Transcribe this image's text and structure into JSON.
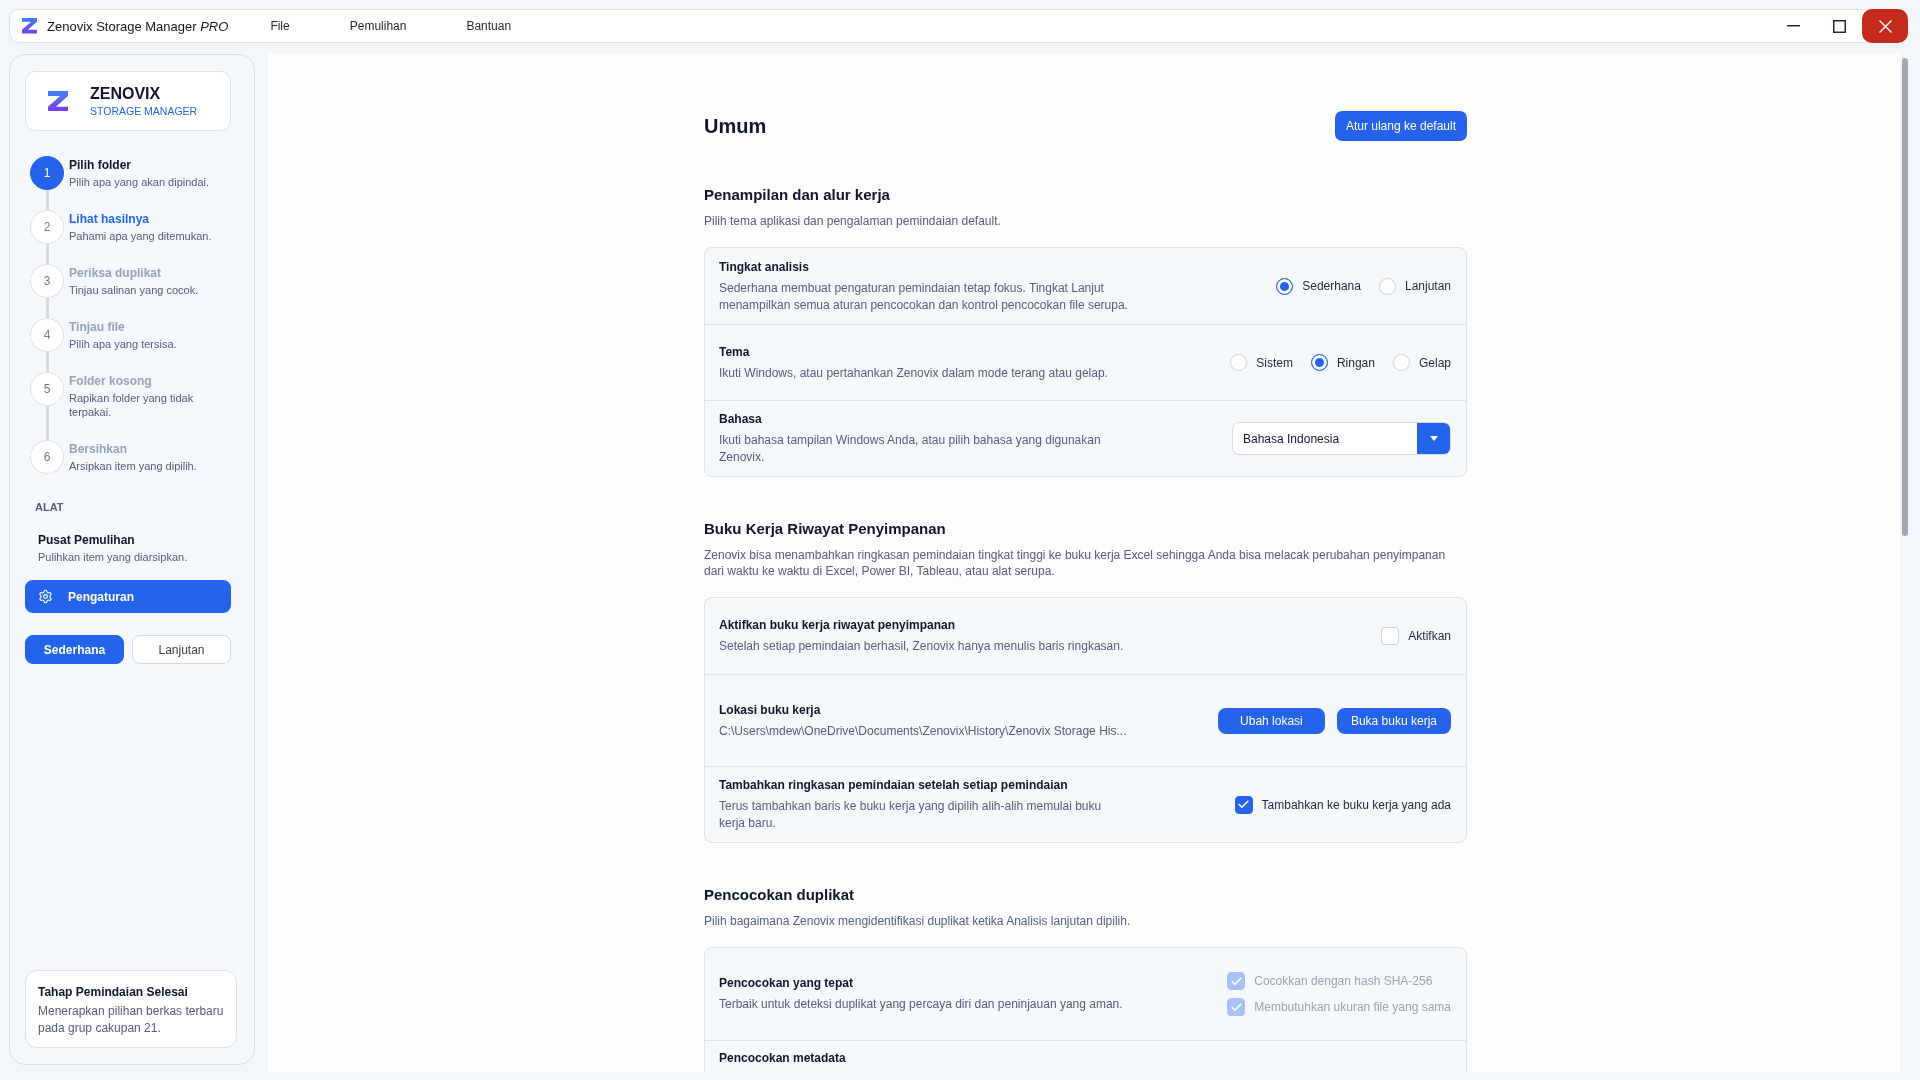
{
  "window": {
    "title": "Zenovix Storage Manager *PRO*",
    "menu": [
      {
        "label": "File"
      },
      {
        "label": "Pemulihan"
      },
      {
        "label": "Bantuan"
      }
    ]
  },
  "sidebar": {
    "brand": {
      "name": "ZENOVIX",
      "tagline": "STORAGE MANAGER"
    },
    "steps": [
      {
        "number": "1",
        "title": "Pilih folder",
        "description": "Pilih apa yang akan dipindai.",
        "completed": true,
        "selected": false
      },
      {
        "number": "2",
        "title": "Lihat hasilnya",
        "description": "Pahami apa yang ditemukan.",
        "completed": false,
        "selected": true
      },
      {
        "number": "3",
        "title": "Periksa duplikat",
        "description": "Tinjau salinan yang cocok.",
        "completed": false,
        "selected": false
      },
      {
        "number": "4",
        "title": "Tinjau file",
        "description": "Pilih apa yang tersisa.",
        "completed": false,
        "selected": false
      },
      {
        "number": "5",
        "title": "Folder kosong",
        "description": "Rapikan folder yang tidak terpakai.",
        "completed": false,
        "selected": false
      },
      {
        "number": "6",
        "title": "Bersihkan",
        "description": "Arsipkan item yang dipilih.",
        "completed": false,
        "selected": false
      }
    ],
    "tools_heading": "ALAT",
    "tools": [
      {
        "kind": "page",
        "title": "Pusat Pemulihan",
        "description": "Pulihkan item yang diarsipkan.",
        "selected": false
      },
      {
        "kind": "settings",
        "title": "Pengaturan",
        "selected": true
      }
    ],
    "modes": [
      {
        "label": "Sederhana",
        "selected": true
      },
      {
        "label": "Lanjutan",
        "selected": false
      }
    ],
    "status_card": {
      "title": "Tahap Pemindaian Selesai",
      "text": "Menerapkan pilihan berkas terbaru pada grup cakupan 21."
    }
  },
  "settings": {
    "title": "Umum",
    "reset_button": "Atur ulang ke default",
    "sections": [
      {
        "heading": "Penampilan dan alur kerja",
        "description": "Pilih tema aplikasi dan pengalaman pemindaian default.",
        "rows": [
          {
            "kind": "radio",
            "title": "Tingkat analisis",
            "description": "Sederhana membuat pengaturan pemindaian tetap fokus. Tingkat Lanjut menampilkan semua aturan pencocokan dan kontrol pencocokan file serupa.",
            "options": [
              {
                "label": "Sederhana",
                "selected": true
              },
              {
                "label": "Lanjutan",
                "selected": false
              }
            ]
          },
          {
            "kind": "radio",
            "title": "Tema",
            "description": "Ikuti Windows, atau pertahankan Zenovix dalam mode terang atau gelap.",
            "options": [
              {
                "label": "Sistem",
                "selected": false
              },
              {
                "label": "Ringan",
                "selected": true
              },
              {
                "label": "Gelap",
                "selected": false
              }
            ]
          },
          {
            "kind": "select",
            "title": "Bahasa",
            "description": "Ikuti bahasa tampilan Windows Anda, atau pilih bahasa yang digunakan Zenovix.",
            "value": "Bahasa Indonesia"
          }
        ]
      },
      {
        "heading": "Buku Kerja Riwayat Penyimpanan",
        "description": "Zenovix bisa menambahkan ringkasan pemindaian tingkat tinggi ke buku kerja Excel sehingga Anda bisa melacak perubahan penyimpanan dari waktu ke waktu di Excel, Power BI, Tableau, atau alat serupa.",
        "rows": [
          {
            "kind": "checkbox",
            "title": "Aktifkan buku kerja riwayat penyimpanan",
            "description": "Setelah setiap pemindaian berhasil, Zenovix hanya menulis baris ringkasan.",
            "options": [
              {
                "label": "Aktifkan",
                "checked": false,
                "disabled": false
              }
            ]
          },
          {
            "kind": "buttons",
            "title": "Lokasi buku kerja",
            "path": "C:\\Users\\mdew\\OneDrive\\Documents\\Zenovix\\History\\Zenovix Storage His...",
            "buttons": [
              {
                "label": "Ubah lokasi"
              },
              {
                "label": "Buka buku kerja"
              }
            ]
          },
          {
            "kind": "checkbox",
            "title": "Tambahkan ringkasan pemindaian setelah setiap pemindaian",
            "description": "Terus tambahkan baris ke buku kerja yang dipilih alih-alih memulai buku kerja baru.",
            "options": [
              {
                "label": "Tambahkan ke buku kerja yang ada",
                "checked": true,
                "disabled": false
              }
            ]
          }
        ]
      },
      {
        "heading": "Pencocokan duplikat",
        "description": "Pilih bagaimana Zenovix mengidentifikasi duplikat ketika Analisis lanjutan dipilih.",
        "rows": [
          {
            "kind": "checkbox",
            "title": "Pencocokan yang tepat",
            "description": "Terbaik untuk deteksi duplikat yang percaya diri dan peninjauan yang aman.",
            "options": [
              {
                "label": "Cocokkan dengan hash SHA-256",
                "checked": true,
                "disabled": true
              },
              {
                "label": "Membutuhkan ukuran file yang sama",
                "checked": true,
                "disabled": true
              }
            ]
          },
          {
            "kind": "checkbox",
            "title": "Pencocokan metadata"
          }
        ]
      }
    ]
  }
}
